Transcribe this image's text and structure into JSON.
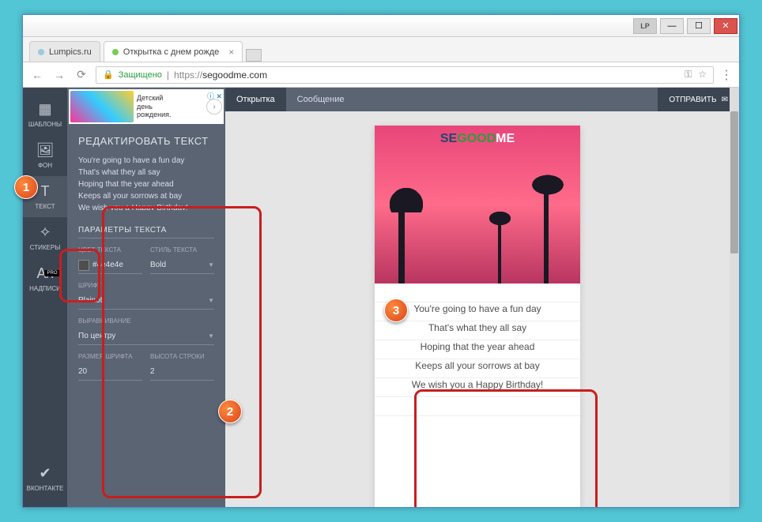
{
  "window": {
    "profile": "LP"
  },
  "tabs": [
    {
      "title": "Lumpics.ru"
    },
    {
      "title": "Открытка с днем рожде"
    }
  ],
  "address": {
    "secure_label": "Защищено",
    "url_prefix": "https://",
    "url_host": "segoodme.com",
    "key_icon": "⚿",
    "star_icon": "☆"
  },
  "sidebar": {
    "templates": "ШАБЛОНЫ",
    "background": "ФОН",
    "text": "ТЕКСТ",
    "stickers": "СТИКЕРЫ",
    "captions": "НАДПИСИ",
    "pro": "PRO",
    "vk": "ВКОНТАКТЕ"
  },
  "ad": {
    "line1": "Детский",
    "line2": "день",
    "line3": "рождения."
  },
  "panel": {
    "edit_title": "РЕДАКТИРОВАТЬ ТЕКСТ",
    "lines": [
      "You're going to have a fun day",
      "That's what they all say",
      "Hoping that the year ahead",
      "Keeps all your sorrows at bay",
      "We wish you a Happy Birthday!"
    ],
    "params_title": "ПАРАМЕТРЫ ТЕКСТА",
    "color_label": "ЦВЕТ ТЕКСТА",
    "color_value": "#4e4e4e",
    "style_label": "СТИЛЬ ТЕКСТА",
    "style_value": "Bold",
    "font_label": "ШРИФТ",
    "font_value": "Plainot",
    "align_label": "ВЫРАВНИВАНИЕ",
    "align_value": "По центру",
    "size_label": "РАЗМЕР ШРИФТА",
    "size_value": "20",
    "lineh_label": "ВЫСОТА СТРОКИ",
    "lineh_value": "2"
  },
  "topbar": {
    "card_tab": "Открытка",
    "msg_tab": "Сообщение",
    "send": "ОТПРАВИТЬ"
  },
  "card": {
    "logo_1": "SE",
    "logo_2": "GOOD",
    "logo_3": "ME",
    "text": [
      "You're going to have a fun day",
      "That's what they all say",
      "Hoping that the year ahead",
      "Keeps all your sorrows at bay",
      "We wish you a Happy Birthday!"
    ]
  },
  "markers": {
    "m1": "1",
    "m2": "2",
    "m3": "3"
  }
}
